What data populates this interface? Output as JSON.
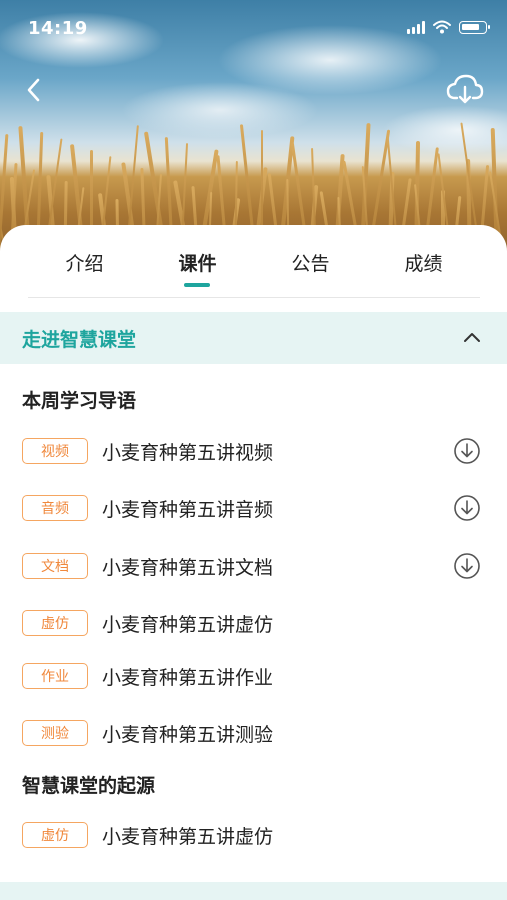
{
  "status_bar": {
    "time": "14:19"
  },
  "header": {
    "back_icon": "chevron-left-icon",
    "download_icon": "cloud-download-icon"
  },
  "tabs": [
    {
      "label": "介绍",
      "active": false
    },
    {
      "label": "课件",
      "active": true
    },
    {
      "label": "公告",
      "active": false
    },
    {
      "label": "成绩",
      "active": false
    }
  ],
  "section": {
    "title": "走进智慧课堂",
    "expanded": true
  },
  "groups": [
    {
      "title": "本周学习导语",
      "items": [
        {
          "tag": "视频",
          "title": "小麦育种第五讲视频",
          "downloadable": true
        },
        {
          "tag": "音频",
          "title": "小麦育种第五讲音频",
          "downloadable": true
        },
        {
          "tag": "文档",
          "title": "小麦育种第五讲文档",
          "downloadable": true
        },
        {
          "tag": "虚仿",
          "title": "小麦育种第五讲虚仿",
          "downloadable": false
        },
        {
          "tag": "作业",
          "title": "小麦育种第五讲作业",
          "downloadable": false
        },
        {
          "tag": "测验",
          "title": "小麦育种第五讲测验",
          "downloadable": false
        }
      ]
    },
    {
      "title": "智慧课堂的起源",
      "items": [
        {
          "tag": "虚仿",
          "title": "小麦育种第五讲虚仿",
          "downloadable": false
        }
      ]
    }
  ],
  "colors": {
    "accent": "#1ea59e",
    "tag": "#f0883c",
    "section_bg": "#e6f4f3"
  }
}
